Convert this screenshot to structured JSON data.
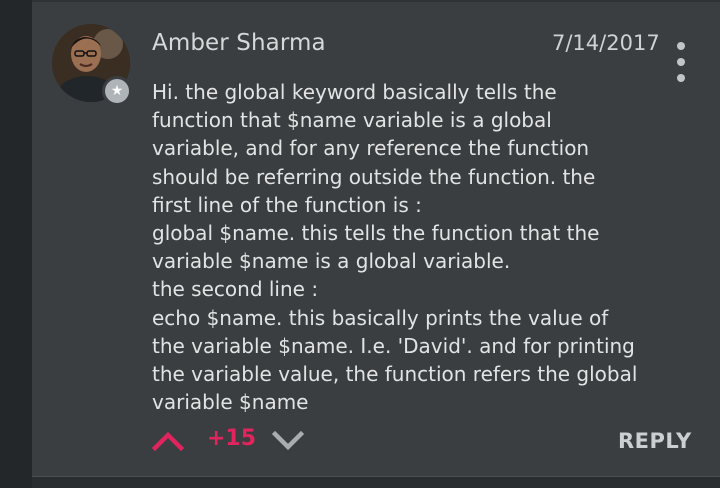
{
  "comment": {
    "author": "Amber Sharma",
    "date": "7/14/2017",
    "body_lines": [
      "Hi. the global keyword basically tells the",
      "function that $name variable is a global",
      "variable, and for any reference the function",
      "should be referring outside the function. the",
      "first line of the function is :",
      "global $name. this tells the function that the",
      "variable $name is a global variable.",
      "the second line :",
      "echo $name. this basically prints the value of",
      "the variable $name. I.e. 'David'. and for printing",
      "the variable value, the function refers the global",
      "variable $name"
    ],
    "votes": "+15",
    "reply_label": "REPLY",
    "badge_icon": "star-icon"
  },
  "colors": {
    "background": "#2b2f31",
    "card": "#3a3e40",
    "text": "#e1e3e4",
    "accent_vote": "#e0245e",
    "muted_icon": "#a8adb0"
  }
}
